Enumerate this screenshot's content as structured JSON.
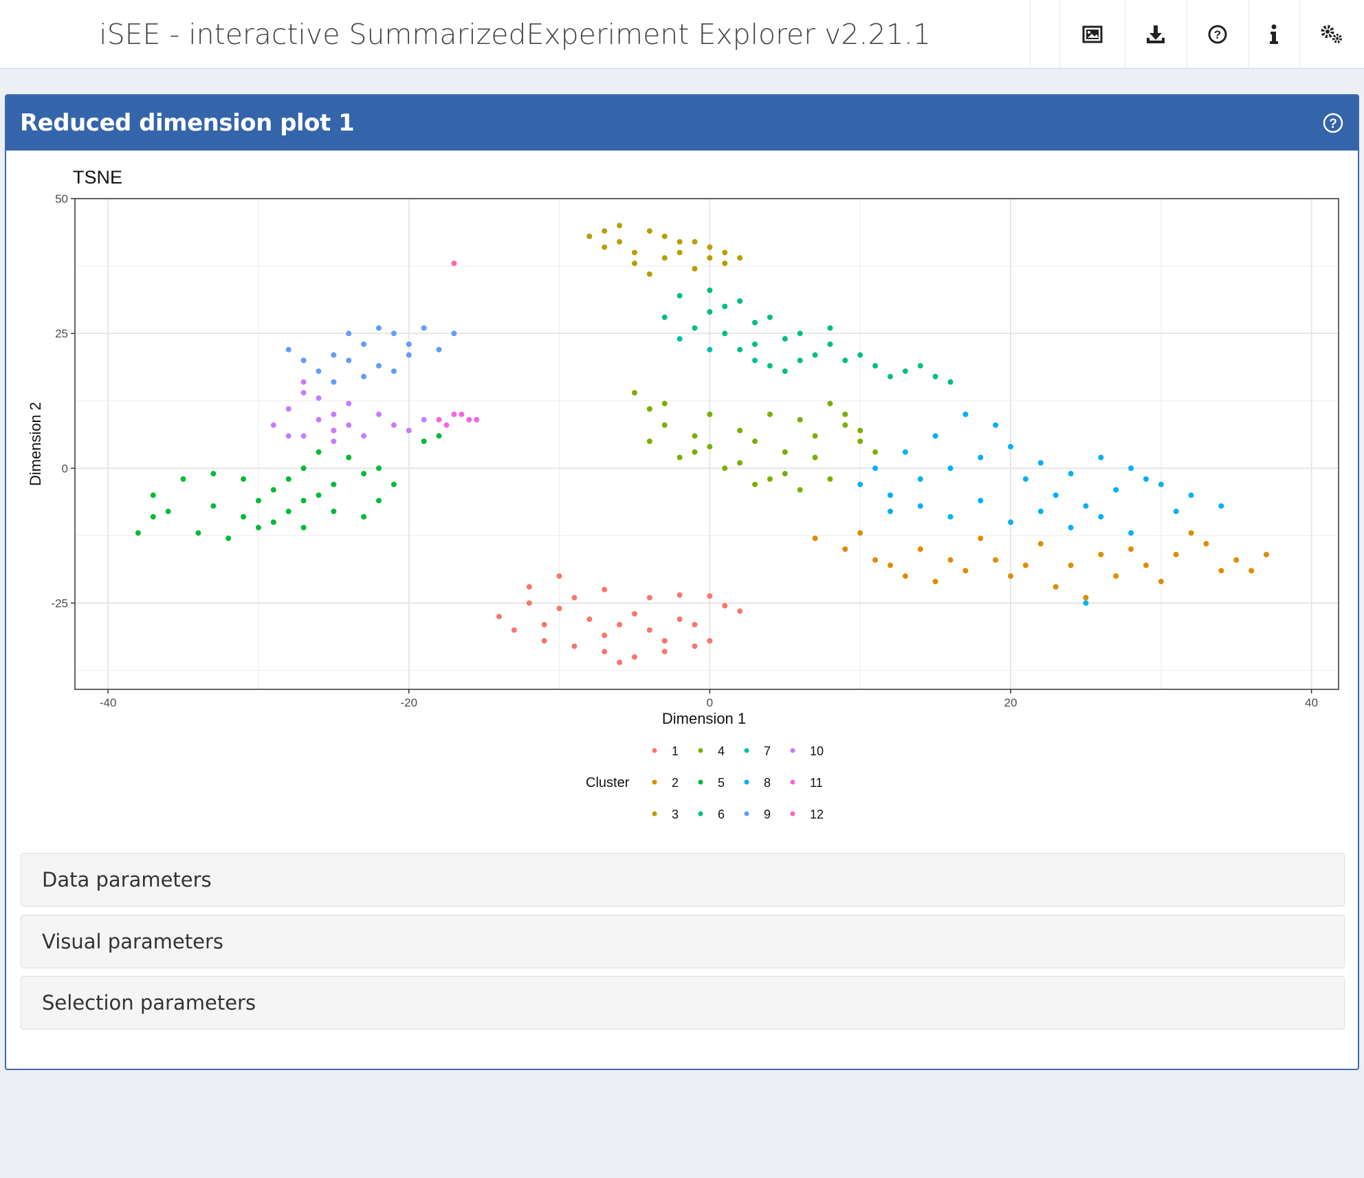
{
  "header": {
    "title": "iSEE - interactive SummarizedExperiment Explorer v2.21.1",
    "buttons": [
      {
        "name": "screenshot-button",
        "icon": "image-icon"
      },
      {
        "name": "download-button",
        "icon": "download-icon"
      },
      {
        "name": "help-button",
        "icon": "question-circle-icon"
      },
      {
        "name": "info-button",
        "icon": "info-icon"
      },
      {
        "name": "settings-button",
        "icon": "cogs-icon"
      }
    ]
  },
  "panel": {
    "title": "Reduced dimension plot 1",
    "help_icon": "question-circle-icon",
    "header_color": "#3465aa"
  },
  "sections": [
    {
      "label": "Data parameters"
    },
    {
      "label": "Visual parameters"
    },
    {
      "label": "Selection parameters"
    }
  ],
  "chart_data": {
    "type": "scatter",
    "title": "TSNE",
    "xlabel": "Dimension 1",
    "ylabel": "Dimension 2",
    "xlim": [
      -42.2,
      41.8
    ],
    "ylim": [
      -41,
      50
    ],
    "xticks": [
      -40,
      -20,
      0,
      20,
      40
    ],
    "yticks": [
      -25,
      0,
      25,
      50
    ],
    "grid": true,
    "legend": {
      "title": "Cluster",
      "position": "bottom"
    },
    "series": [
      {
        "name": "1",
        "color": "#F8766D",
        "points": [
          [
            -14,
            -27.5
          ],
          [
            -12,
            -22
          ],
          [
            -10,
            -20
          ],
          [
            -7,
            -22.5
          ],
          [
            -4,
            -24
          ],
          [
            -2,
            -23.5
          ],
          [
            0,
            -23.7
          ],
          [
            1,
            -25.5
          ],
          [
            2,
            -26.5
          ],
          [
            -13,
            -30
          ],
          [
            -11,
            -32
          ],
          [
            -9,
            -33
          ],
          [
            -7,
            -34
          ],
          [
            -5,
            -35
          ],
          [
            -3,
            -34
          ],
          [
            -1,
            -33
          ],
          [
            0,
            -32
          ],
          [
            -8,
            -28
          ],
          [
            -6,
            -29
          ],
          [
            -4,
            -30
          ],
          [
            -2,
            -28
          ],
          [
            -10,
            -26
          ],
          [
            -12,
            -25
          ],
          [
            -6,
            -36
          ],
          [
            -3,
            -32
          ],
          [
            -9,
            -24
          ],
          [
            -11,
            -29
          ],
          [
            -5,
            -27
          ],
          [
            -1,
            -29
          ],
          [
            -7,
            -31
          ]
        ]
      },
      {
        "name": "2",
        "color": "#DE8C00",
        "points": [
          [
            7,
            -13
          ],
          [
            9,
            -15
          ],
          [
            11,
            -17
          ],
          [
            13,
            -20
          ],
          [
            15,
            -21
          ],
          [
            17,
            -19
          ],
          [
            19,
            -17
          ],
          [
            21,
            -18
          ],
          [
            23,
            -22
          ],
          [
            25,
            -24
          ],
          [
            27,
            -20
          ],
          [
            29,
            -18
          ],
          [
            31,
            -16
          ],
          [
            33,
            -14
          ],
          [
            35,
            -17
          ],
          [
            37,
            -16
          ],
          [
            34,
            -19
          ],
          [
            30,
            -21
          ],
          [
            26,
            -16
          ],
          [
            22,
            -14
          ],
          [
            18,
            -13
          ],
          [
            14,
            -15
          ],
          [
            10,
            -12
          ],
          [
            12,
            -18
          ],
          [
            16,
            -17
          ],
          [
            20,
            -20
          ],
          [
            24,
            -18
          ],
          [
            28,
            -15
          ],
          [
            32,
            -12
          ],
          [
            36,
            -19
          ]
        ]
      },
      {
        "name": "3",
        "color": "#B79F00",
        "points": [
          [
            -8,
            43
          ],
          [
            -6,
            45
          ],
          [
            -4,
            44
          ],
          [
            -2,
            42
          ],
          [
            0,
            41
          ],
          [
            2,
            39
          ],
          [
            -7,
            41
          ],
          [
            -5,
            40
          ],
          [
            -3,
            39
          ],
          [
            -1,
            37
          ],
          [
            1,
            38
          ],
          [
            -4,
            36
          ],
          [
            -6,
            42
          ],
          [
            -2,
            40
          ],
          [
            0,
            39
          ],
          [
            -3,
            43
          ],
          [
            -5,
            38
          ],
          [
            1,
            40
          ],
          [
            -7,
            44
          ],
          [
            -1,
            42
          ]
        ]
      },
      {
        "name": "4",
        "color": "#7CAE00",
        "points": [
          [
            -5,
            14
          ],
          [
            -4,
            11
          ],
          [
            -3,
            8
          ],
          [
            -1,
            6
          ],
          [
            0,
            4
          ],
          [
            2,
            7
          ],
          [
            4,
            10
          ],
          [
            6,
            9
          ],
          [
            8,
            12
          ],
          [
            9,
            8
          ],
          [
            10,
            5
          ],
          [
            11,
            3
          ],
          [
            7,
            2
          ],
          [
            5,
            -1
          ],
          [
            3,
            -3
          ],
          [
            1,
            0
          ],
          [
            -2,
            2
          ],
          [
            -4,
            5
          ],
          [
            6,
            -4
          ],
          [
            8,
            -2
          ],
          [
            3,
            5
          ],
          [
            5,
            3
          ],
          [
            7,
            6
          ],
          [
            9,
            10
          ],
          [
            0,
            10
          ],
          [
            -3,
            12
          ],
          [
            2,
            1
          ],
          [
            4,
            -2
          ],
          [
            10,
            7
          ],
          [
            -1,
            3
          ]
        ]
      },
      {
        "name": "5",
        "color": "#00BA38",
        "points": [
          [
            -38,
            -12
          ],
          [
            -37,
            -5
          ],
          [
            -35,
            -2
          ],
          [
            -33,
            -1
          ],
          [
            -31,
            -2
          ],
          [
            -29,
            -4
          ],
          [
            -27,
            -6
          ],
          [
            -25,
            -8
          ],
          [
            -23,
            -9
          ],
          [
            -22,
            -6
          ],
          [
            -21,
            -3
          ],
          [
            -22,
            0
          ],
          [
            -24,
            2
          ],
          [
            -26,
            3
          ],
          [
            -27,
            0
          ],
          [
            -28,
            -8
          ],
          [
            -30,
            -11
          ],
          [
            -32,
            -13
          ],
          [
            -34,
            -12
          ],
          [
            -36,
            -8
          ],
          [
            -33,
            -7
          ],
          [
            -31,
            -9
          ],
          [
            -29,
            -10
          ],
          [
            -27,
            -11
          ],
          [
            -25,
            -3
          ],
          [
            -23,
            -1
          ],
          [
            -26,
            -5
          ],
          [
            -28,
            -2
          ],
          [
            -19,
            5
          ],
          [
            -18,
            6
          ],
          [
            -37,
            -9
          ],
          [
            -30,
            -6
          ]
        ]
      },
      {
        "name": "6",
        "color": "#00BF7D",
        "points": [
          [
            -3,
            28
          ],
          [
            -2,
            32
          ],
          [
            0,
            33
          ],
          [
            1,
            30
          ],
          [
            3,
            27
          ],
          [
            5,
            24
          ],
          [
            7,
            21
          ],
          [
            9,
            20
          ],
          [
            11,
            19
          ],
          [
            13,
            18
          ],
          [
            15,
            17
          ],
          [
            2,
            22
          ],
          [
            4,
            19
          ],
          [
            6,
            20
          ],
          [
            8,
            23
          ],
          [
            10,
            21
          ],
          [
            12,
            17
          ],
          [
            -1,
            26
          ],
          [
            1,
            25
          ],
          [
            3,
            23
          ],
          [
            0,
            29
          ],
          [
            2,
            31
          ],
          [
            4,
            28
          ],
          [
            6,
            25
          ],
          [
            14,
            19
          ],
          [
            16,
            16
          ],
          [
            8,
            26
          ],
          [
            5,
            18
          ]
        ]
      },
      {
        "name": "7",
        "color": "#00C1A3",
        "points": [
          [
            -2,
            24
          ],
          [
            0,
            22
          ],
          [
            3,
            20
          ]
        ]
      },
      {
        "name": "8",
        "color": "#00B0F6",
        "points": [
          [
            10,
            -3
          ],
          [
            12,
            -5
          ],
          [
            14,
            -2
          ],
          [
            16,
            0
          ],
          [
            18,
            2
          ],
          [
            20,
            4
          ],
          [
            22,
            1
          ],
          [
            24,
            -1
          ],
          [
            26,
            2
          ],
          [
            28,
            0
          ],
          [
            30,
            -3
          ],
          [
            32,
            -5
          ],
          [
            34,
            -7
          ],
          [
            22,
            -8
          ],
          [
            24,
            -11
          ],
          [
            26,
            -9
          ],
          [
            28,
            -12
          ],
          [
            18,
            -6
          ],
          [
            16,
            -9
          ],
          [
            14,
            -7
          ],
          [
            12,
            -8
          ],
          [
            19,
            8
          ],
          [
            17,
            10
          ],
          [
            15,
            6
          ],
          [
            21,
            -2
          ],
          [
            23,
            -5
          ],
          [
            25,
            -7
          ],
          [
            27,
            -4
          ],
          [
            29,
            -2
          ],
          [
            31,
            -8
          ],
          [
            13,
            3
          ],
          [
            11,
            0
          ],
          [
            20,
            -10
          ],
          [
            25,
            -25
          ]
        ]
      },
      {
        "name": "9",
        "color": "#619CFF",
        "points": [
          [
            -25,
            21
          ],
          [
            -23,
            23
          ],
          [
            -21,
            25
          ],
          [
            -19,
            26
          ],
          [
            -17,
            25
          ],
          [
            -20,
            21
          ],
          [
            -22,
            19
          ],
          [
            -24,
            20
          ],
          [
            -26,
            18
          ],
          [
            -27,
            20
          ],
          [
            -28,
            22
          ],
          [
            -22,
            26
          ],
          [
            -24,
            25
          ],
          [
            -20,
            23
          ],
          [
            -18,
            22
          ],
          [
            -21,
            18
          ],
          [
            -23,
            17
          ],
          [
            -25,
            16
          ]
        ]
      },
      {
        "name": "10",
        "color": "#C77CFF",
        "points": [
          [
            -27,
            16
          ],
          [
            -26,
            13
          ],
          [
            -25,
            10
          ],
          [
            -24,
            8
          ],
          [
            -23,
            6
          ],
          [
            -25,
            5
          ],
          [
            -27,
            6
          ],
          [
            -29,
            8
          ],
          [
            -28,
            11
          ],
          [
            -26,
            9
          ],
          [
            -24,
            12
          ],
          [
            -22,
            10
          ],
          [
            -21,
            8
          ],
          [
            -20,
            7
          ],
          [
            -19,
            9
          ],
          [
            -27,
            14
          ],
          [
            -25,
            7
          ],
          [
            -28,
            6
          ]
        ]
      },
      {
        "name": "11",
        "color": "#F564E3",
        "points": [
          [
            -18,
            9
          ],
          [
            -17,
            10
          ],
          [
            -16,
            9
          ],
          [
            -15.5,
            9
          ],
          [
            -17.5,
            8
          ],
          [
            -16.5,
            10
          ]
        ]
      },
      {
        "name": "12",
        "color": "#FF64B0",
        "points": [
          [
            -17,
            38
          ]
        ]
      }
    ]
  }
}
